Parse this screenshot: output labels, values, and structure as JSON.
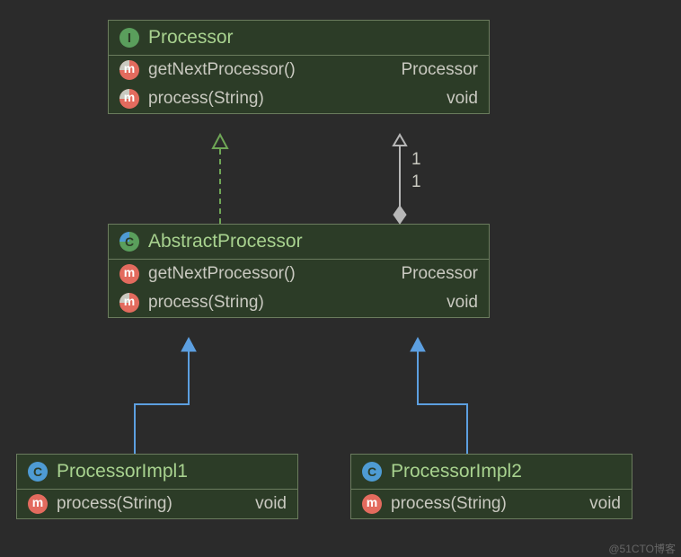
{
  "classes": {
    "processor": {
      "name": "Processor",
      "stereotype": "interface",
      "methods": [
        {
          "name": "getNextProcessor()",
          "return": "Processor"
        },
        {
          "name": "process(String)",
          "return": "void"
        }
      ]
    },
    "abstract_processor": {
      "name": "AbstractProcessor",
      "stereotype": "abstract",
      "methods": [
        {
          "name": "getNextProcessor()",
          "return": "Processor"
        },
        {
          "name": "process(String)",
          "return": "void"
        }
      ]
    },
    "impl1": {
      "name": "ProcessorImpl1",
      "stereotype": "class",
      "methods": [
        {
          "name": "process(String)",
          "return": "void"
        }
      ]
    },
    "impl2": {
      "name": "ProcessorImpl2",
      "stereotype": "class",
      "methods": [
        {
          "name": "process(String)",
          "return": "void"
        }
      ]
    }
  },
  "relationships": {
    "aggregation_multiplicity_top": "1",
    "aggregation_multiplicity_bottom": "1"
  },
  "watermark": "@51CTO博客"
}
